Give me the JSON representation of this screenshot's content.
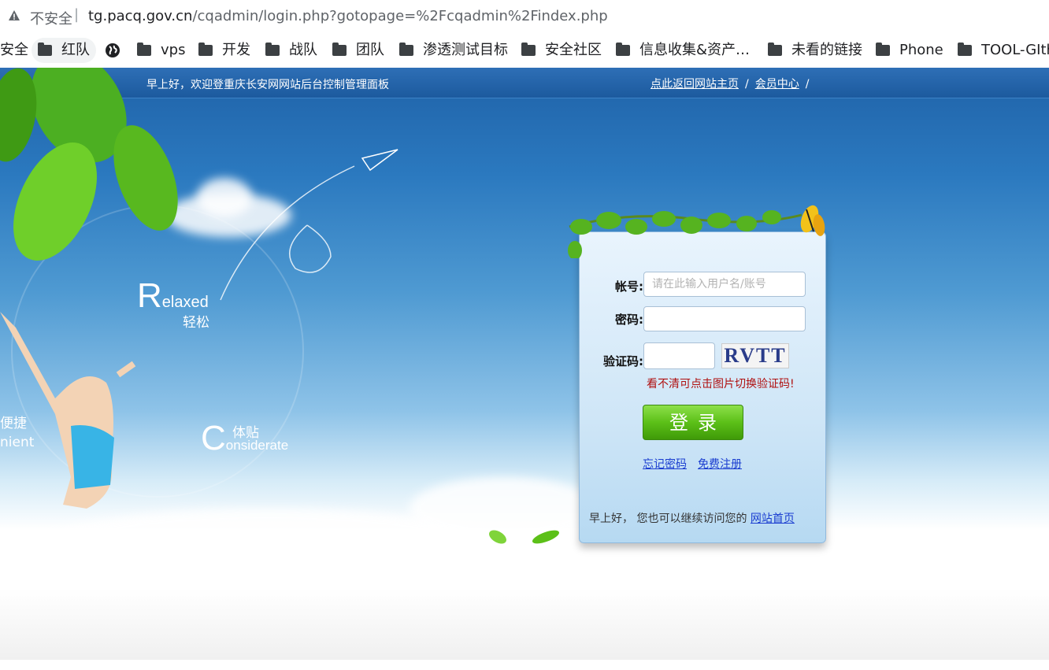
{
  "browser": {
    "insecure_label": "不安全",
    "url_host": "tg.pacq.gov.cn",
    "url_path": "/cqadmin/login.php?gotopage=%2Fcqadmin%2Findex.php"
  },
  "bookmarks": [
    {
      "label": "安全",
      "icon": "folder-icon"
    },
    {
      "label": "红队",
      "icon": "folder-icon"
    },
    {
      "label": "",
      "icon": "globe-icon"
    },
    {
      "label": "vps",
      "icon": "folder-icon"
    },
    {
      "label": "开发",
      "icon": "folder-icon"
    },
    {
      "label": "战队",
      "icon": "folder-icon"
    },
    {
      "label": "团队",
      "icon": "folder-icon"
    },
    {
      "label": "渗透测试目标",
      "icon": "folder-icon"
    },
    {
      "label": "安全社区",
      "icon": "folder-icon"
    },
    {
      "label": "信息收集&资产…",
      "icon": "folder-icon"
    },
    {
      "label": "未看的链接",
      "icon": "folder-icon"
    },
    {
      "label": "Phone",
      "icon": "folder-icon"
    },
    {
      "label": "TOOL-GIth",
      "icon": "folder-icon"
    }
  ],
  "header": {
    "greeting": "早上好，欢迎登重庆长安网网站后台控制管理面板",
    "home_link": "点此返回网站主页",
    "member_link": "会员中心",
    "slash": "/"
  },
  "banner": {
    "relaxed_first": "R",
    "relaxed_rest": "elaxed",
    "relaxed_cn": "轻松",
    "considerate_first": "C",
    "considerate_rest": "onsiderate",
    "considerate_cn": "体贴",
    "convenient_cn": "便捷",
    "convenient_en": "nient"
  },
  "login": {
    "username_label": "帐号:",
    "username_placeholder": "请在此输入用户名/账号",
    "password_label": "密码:",
    "captcha_label": "验证码:",
    "captcha_text": "RVTT",
    "captcha_hint": "看不清可点击图片切换验证码!",
    "submit_label": "登录",
    "forgot_password": "忘记密码",
    "register": "免费注册",
    "footer_text": "早上好， 您也可以继续访问您的",
    "footer_link": "网站首页"
  },
  "colors": {
    "header_bar": "#1c5a9e",
    "login_button": "#5cc018",
    "hint_text": "#b01010",
    "link": "#1a3dd0"
  }
}
